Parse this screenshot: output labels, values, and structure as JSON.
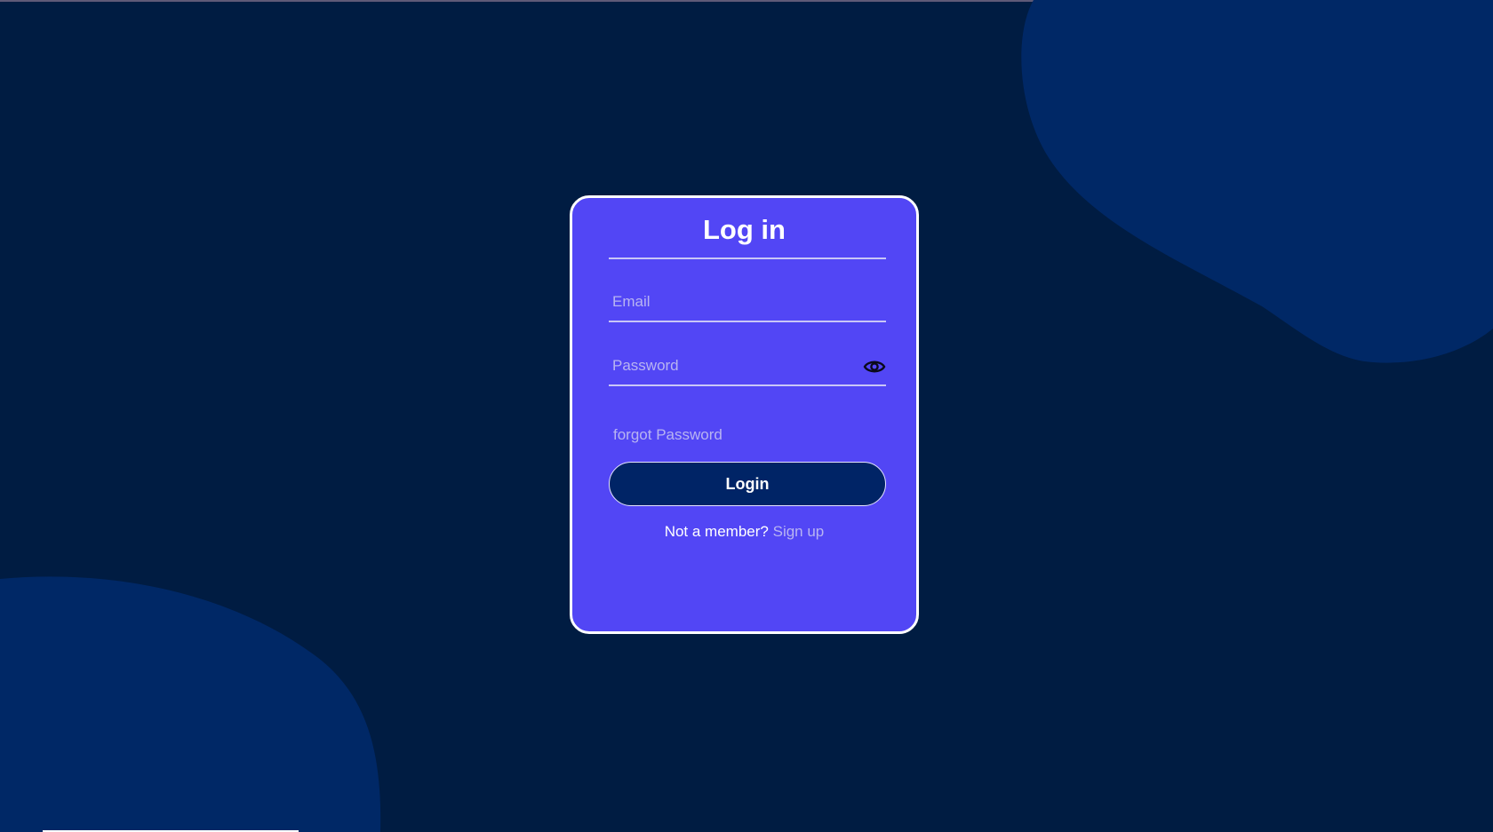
{
  "login_card": {
    "title": "Log in",
    "email_placeholder": "Email",
    "password_placeholder": "Password",
    "forgot_password": "forgot Password",
    "login_button": "Login",
    "signup_prompt": "Not a member?",
    "signup_link": "Sign up"
  },
  "colors": {
    "background": "#001c42",
    "blob": "#002866",
    "card": "#5246f5",
    "button": "#002466",
    "muted_text": "#b8b4f2"
  },
  "icons": {
    "password_toggle": "eye-icon"
  }
}
